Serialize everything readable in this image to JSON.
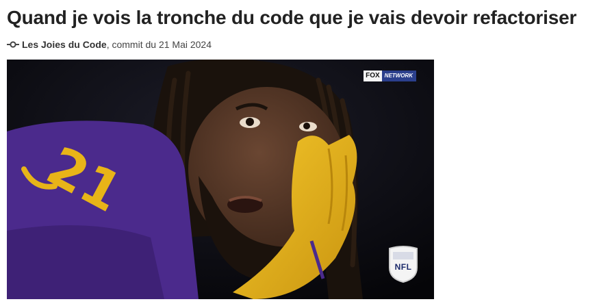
{
  "post": {
    "title": "Quand je vois la tronche du code que je vais devoir refactoriser",
    "author": "Les Joies du Code",
    "meta_suffix": ", commit du 21 Mai 2024"
  },
  "media": {
    "network_logo": {
      "left": "FOX",
      "right": "NETWORK"
    },
    "league_logo": "NFL",
    "jersey_number": "21"
  },
  "colors": {
    "jersey_purple": "#4b2a8c",
    "glove_gold": "#e8b418",
    "background": "#ffffff"
  },
  "icons": {
    "commit": "commit-icon"
  }
}
